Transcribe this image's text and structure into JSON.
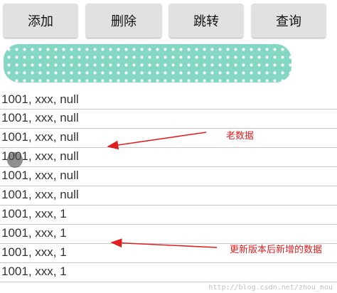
{
  "toolbar": {
    "add_label": "添加",
    "delete_label": "删除",
    "jump_label": "跳转",
    "query_label": "查询"
  },
  "list": {
    "items": [
      "1001, xxx, null",
      "1001, xxx, null",
      "1001, xxx, null",
      "1001, xxx, null",
      "1001, xxx, null",
      "1001, xxx, null",
      "1001, xxx, 1",
      "1001, xxx, 1",
      "1001, xxx, 1",
      "1001, xxx, 1"
    ]
  },
  "annotations": {
    "old_data": "老数据",
    "new_data": "更新版本后新增的数据"
  },
  "watermark": "http://blog.csdn.net/zhou_mou",
  "colors": {
    "banner": "#84d7c3",
    "annotation": "#e02020"
  }
}
